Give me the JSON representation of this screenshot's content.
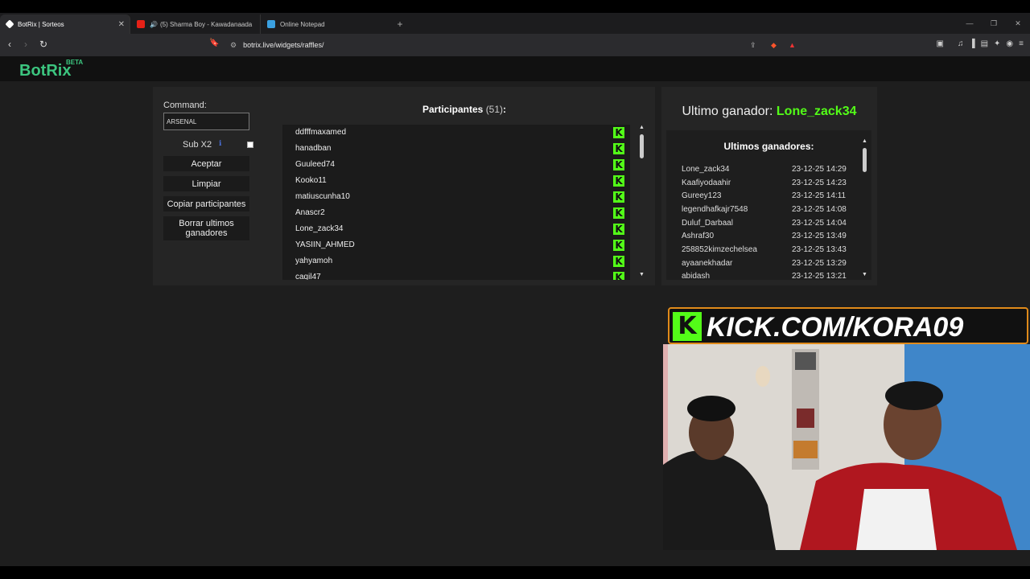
{
  "browser": {
    "tabs": [
      {
        "title": "BotRix | Sorteos",
        "active": true
      },
      {
        "title": "(5) Sharma Boy - Kawadanaada",
        "active": false
      },
      {
        "title": "Online Notepad",
        "active": false
      }
    ],
    "url": "botrix.live/widgets/raffles/"
  },
  "header": {
    "logo": "BotRix",
    "badge": "BETA"
  },
  "controls": {
    "command_label": "Command:",
    "command_value": "ARSENAL",
    "sub_label": "Sub X2",
    "accept": "Aceptar",
    "clear": "Limpiar",
    "copy": "Copiar participantes",
    "delete_winners_line1": "Borrar ultimos",
    "delete_winners_line2": "ganadores"
  },
  "participants": {
    "title": "Participantes",
    "count": "(51)",
    "suffix": ":",
    "items": [
      "ddfffmaxamed",
      "hanadban",
      "Guuleed74",
      "Kooko11",
      "matiuscunha10",
      "Anascr2",
      "Lone_zack34",
      "YASIIN_AHMED",
      "yahyamoh",
      "caqil47"
    ]
  },
  "winners": {
    "last_label": "Ultimo ganador:",
    "last_name": "Lone_zack34",
    "list_title": "Ultimos ganadores:",
    "items": [
      {
        "name": "Lone_zack34",
        "date": "23-12-25 14:29"
      },
      {
        "name": "Kaafiyodaahir",
        "date": "23-12-25 14:23"
      },
      {
        "name": "Gureey123",
        "date": "23-12-25 14:11"
      },
      {
        "name": "legendhafkajr7548",
        "date": "23-12-25 14:08"
      },
      {
        "name": "Duluf_Darbaal",
        "date": "23-12-25 14:04"
      },
      {
        "name": "Ashraf30",
        "date": "23-12-25 13:49"
      },
      {
        "name": "258852kimzechelsea",
        "date": "23-12-25 13:43"
      },
      {
        "name": "ayaanekhadar",
        "date": "23-12-25 13:29"
      },
      {
        "name": "abidash",
        "date": "23-12-25 13:21"
      }
    ]
  },
  "overlay": {
    "kick_letter": "K",
    "banner": "KICK.COM/KORA09"
  },
  "colors": {
    "brand": "#3cc57f",
    "kick": "#53fc18",
    "panel": "#252525"
  }
}
